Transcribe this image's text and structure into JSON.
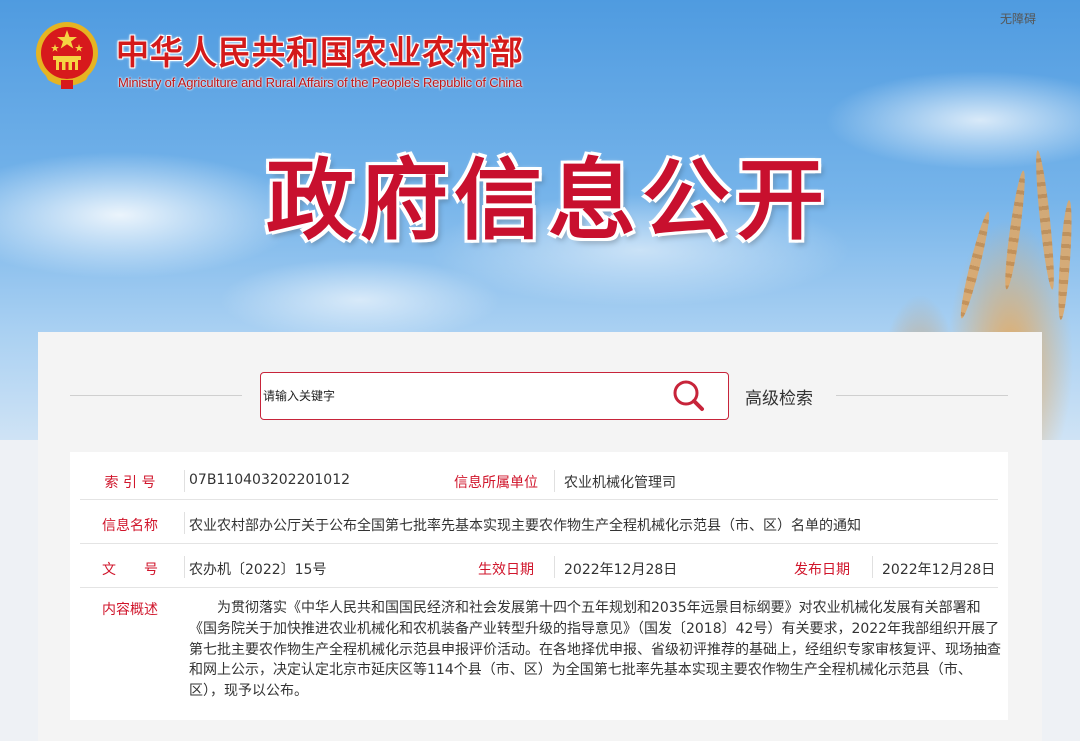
{
  "header": {
    "site_title": "中华人民共和国农业农村部",
    "site_subtitle": "Ministry of Agriculture and Rural Affairs of the People's Republic of China",
    "accessibility_label": "无障碍",
    "hero_title": "政府信息公开"
  },
  "search": {
    "placeholder": "请输入关键字",
    "advanced_label": "高级检索"
  },
  "info": {
    "index_label": "索 引 号",
    "index_value": "07B110403202201012",
    "unit_label": "信息所属单位",
    "unit_value": "农业机械化管理司",
    "name_label": "信息名称",
    "name_value": "农业农村部办公厅关于公布全国第七批率先基本实现主要农作物生产全程机械化示范县（市、区）名单的通知",
    "doc_label": "文　　号",
    "doc_value": "农办机〔2022〕15号",
    "effective_label": "生效日期",
    "effective_value": "2022年12月28日",
    "publish_label": "发布日期",
    "publish_value": "2022年12月28日",
    "summary_label": "内容概述",
    "summary_value": "为贯彻落实《中华人民共和国国民经济和社会发展第十四个五年规划和2035年远景目标纲要》对农业机械化发展有关部署和《国务院关于加快推进农业机械化和农机装备产业转型升级的指导意见》（国发〔2018〕42号）有关要求，2022年我部组织开展了第七批主要农作物生产全程机械化示范县申报评价活动。在各地择优申报、省级初评推荐的基础上，经组织专家审核复评、现场抽查和网上公示，决定认定北京市延庆区等114个县（市、区）为全国第七批率先基本实现主要农作物生产全程机械化示范县（市、区），现予以公布。"
  },
  "colors": {
    "brand_red": "#d0152b",
    "search_border": "#c7243a"
  },
  "icons": {
    "search": "search-icon",
    "emblem": "national-emblem-icon"
  }
}
